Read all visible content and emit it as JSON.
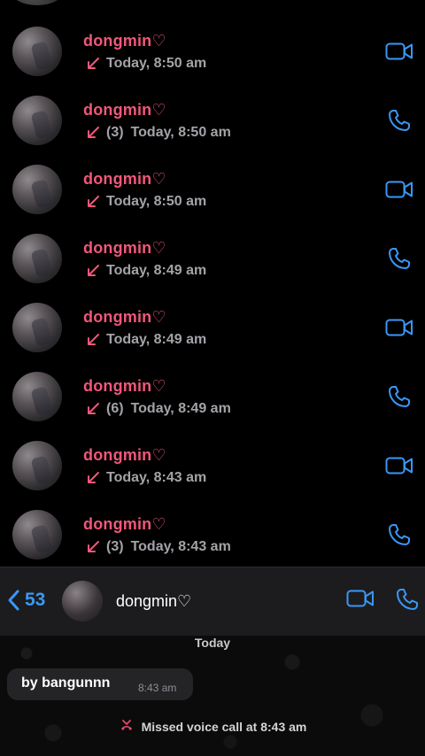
{
  "colors": {
    "name_pink": "#f0587a",
    "accent_blue": "#3a97f5",
    "meta_grey": "#a3a3a8",
    "missed_icon": "#e04a6a"
  },
  "call_list": [
    {
      "name": "dongmin♡",
      "count": "",
      "time": "Today, 8:50 am",
      "direction_icon": "incoming-arrow-icon",
      "action_icon": "video-icon"
    },
    {
      "name": "dongmin♡",
      "count": "(3)",
      "time": "Today, 8:50 am",
      "direction_icon": "incoming-arrow-icon",
      "action_icon": "phone-icon"
    },
    {
      "name": "dongmin♡",
      "count": "",
      "time": "Today, 8:50 am",
      "direction_icon": "incoming-arrow-icon",
      "action_icon": "video-icon"
    },
    {
      "name": "dongmin♡",
      "count": "",
      "time": "Today, 8:49 am",
      "direction_icon": "incoming-arrow-icon",
      "action_icon": "phone-icon"
    },
    {
      "name": "dongmin♡",
      "count": "",
      "time": "Today, 8:49 am",
      "direction_icon": "incoming-arrow-icon",
      "action_icon": "video-icon"
    },
    {
      "name": "dongmin♡",
      "count": "(6)",
      "time": "Today, 8:49 am",
      "direction_icon": "incoming-arrow-icon",
      "action_icon": "phone-icon"
    },
    {
      "name": "dongmin♡",
      "count": "",
      "time": "Today, 8:43 am",
      "direction_icon": "incoming-arrow-icon",
      "action_icon": "video-icon"
    },
    {
      "name": "dongmin♡",
      "count": "(3)",
      "time": "Today, 8:43 am",
      "direction_icon": "incoming-arrow-icon",
      "action_icon": "phone-icon"
    }
  ],
  "chat_header": {
    "back_count": "53",
    "back_icon": "chevron-left-icon",
    "contact_name": "dongmin♡",
    "video_icon": "video-icon",
    "phone_icon": "phone-icon"
  },
  "chat": {
    "date_label": "Today",
    "message": {
      "text": "by bangunnn",
      "time": "8:43 am"
    },
    "system_event": {
      "icon": "missed-call-icon",
      "text": "Missed voice call at 8:43 am"
    }
  }
}
